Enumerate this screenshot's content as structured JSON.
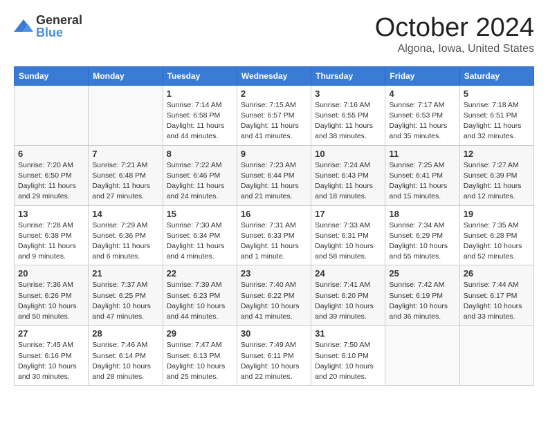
{
  "logo": {
    "general": "General",
    "blue": "Blue"
  },
  "header": {
    "month": "October 2024",
    "location": "Algona, Iowa, United States"
  },
  "weekdays": [
    "Sunday",
    "Monday",
    "Tuesday",
    "Wednesday",
    "Thursday",
    "Friday",
    "Saturday"
  ],
  "weeks": [
    [
      {
        "day": null
      },
      {
        "day": null
      },
      {
        "day": 1,
        "sunrise": "7:14 AM",
        "sunset": "6:58 PM",
        "daylight": "11 hours and 44 minutes."
      },
      {
        "day": 2,
        "sunrise": "7:15 AM",
        "sunset": "6:57 PM",
        "daylight": "11 hours and 41 minutes."
      },
      {
        "day": 3,
        "sunrise": "7:16 AM",
        "sunset": "6:55 PM",
        "daylight": "11 hours and 38 minutes."
      },
      {
        "day": 4,
        "sunrise": "7:17 AM",
        "sunset": "6:53 PM",
        "daylight": "11 hours and 35 minutes."
      },
      {
        "day": 5,
        "sunrise": "7:18 AM",
        "sunset": "6:51 PM",
        "daylight": "11 hours and 32 minutes."
      }
    ],
    [
      {
        "day": 6,
        "sunrise": "7:20 AM",
        "sunset": "6:50 PM",
        "daylight": "11 hours and 29 minutes."
      },
      {
        "day": 7,
        "sunrise": "7:21 AM",
        "sunset": "6:48 PM",
        "daylight": "11 hours and 27 minutes."
      },
      {
        "day": 8,
        "sunrise": "7:22 AM",
        "sunset": "6:46 PM",
        "daylight": "11 hours and 24 minutes."
      },
      {
        "day": 9,
        "sunrise": "7:23 AM",
        "sunset": "6:44 PM",
        "daylight": "11 hours and 21 minutes."
      },
      {
        "day": 10,
        "sunrise": "7:24 AM",
        "sunset": "6:43 PM",
        "daylight": "11 hours and 18 minutes."
      },
      {
        "day": 11,
        "sunrise": "7:25 AM",
        "sunset": "6:41 PM",
        "daylight": "11 hours and 15 minutes."
      },
      {
        "day": 12,
        "sunrise": "7:27 AM",
        "sunset": "6:39 PM",
        "daylight": "11 hours and 12 minutes."
      }
    ],
    [
      {
        "day": 13,
        "sunrise": "7:28 AM",
        "sunset": "6:38 PM",
        "daylight": "11 hours and 9 minutes."
      },
      {
        "day": 14,
        "sunrise": "7:29 AM",
        "sunset": "6:36 PM",
        "daylight": "11 hours and 6 minutes."
      },
      {
        "day": 15,
        "sunrise": "7:30 AM",
        "sunset": "6:34 PM",
        "daylight": "11 hours and 4 minutes."
      },
      {
        "day": 16,
        "sunrise": "7:31 AM",
        "sunset": "6:33 PM",
        "daylight": "11 hours and 1 minute."
      },
      {
        "day": 17,
        "sunrise": "7:33 AM",
        "sunset": "6:31 PM",
        "daylight": "10 hours and 58 minutes."
      },
      {
        "day": 18,
        "sunrise": "7:34 AM",
        "sunset": "6:29 PM",
        "daylight": "10 hours and 55 minutes."
      },
      {
        "day": 19,
        "sunrise": "7:35 AM",
        "sunset": "6:28 PM",
        "daylight": "10 hours and 52 minutes."
      }
    ],
    [
      {
        "day": 20,
        "sunrise": "7:36 AM",
        "sunset": "6:26 PM",
        "daylight": "10 hours and 50 minutes."
      },
      {
        "day": 21,
        "sunrise": "7:37 AM",
        "sunset": "6:25 PM",
        "daylight": "10 hours and 47 minutes."
      },
      {
        "day": 22,
        "sunrise": "7:39 AM",
        "sunset": "6:23 PM",
        "daylight": "10 hours and 44 minutes."
      },
      {
        "day": 23,
        "sunrise": "7:40 AM",
        "sunset": "6:22 PM",
        "daylight": "10 hours and 41 minutes."
      },
      {
        "day": 24,
        "sunrise": "7:41 AM",
        "sunset": "6:20 PM",
        "daylight": "10 hours and 39 minutes."
      },
      {
        "day": 25,
        "sunrise": "7:42 AM",
        "sunset": "6:19 PM",
        "daylight": "10 hours and 36 minutes."
      },
      {
        "day": 26,
        "sunrise": "7:44 AM",
        "sunset": "6:17 PM",
        "daylight": "10 hours and 33 minutes."
      }
    ],
    [
      {
        "day": 27,
        "sunrise": "7:45 AM",
        "sunset": "6:16 PM",
        "daylight": "10 hours and 30 minutes."
      },
      {
        "day": 28,
        "sunrise": "7:46 AM",
        "sunset": "6:14 PM",
        "daylight": "10 hours and 28 minutes."
      },
      {
        "day": 29,
        "sunrise": "7:47 AM",
        "sunset": "6:13 PM",
        "daylight": "10 hours and 25 minutes."
      },
      {
        "day": 30,
        "sunrise": "7:49 AM",
        "sunset": "6:11 PM",
        "daylight": "10 hours and 22 minutes."
      },
      {
        "day": 31,
        "sunrise": "7:50 AM",
        "sunset": "6:10 PM",
        "daylight": "10 hours and 20 minutes."
      },
      {
        "day": null
      },
      {
        "day": null
      }
    ]
  ]
}
